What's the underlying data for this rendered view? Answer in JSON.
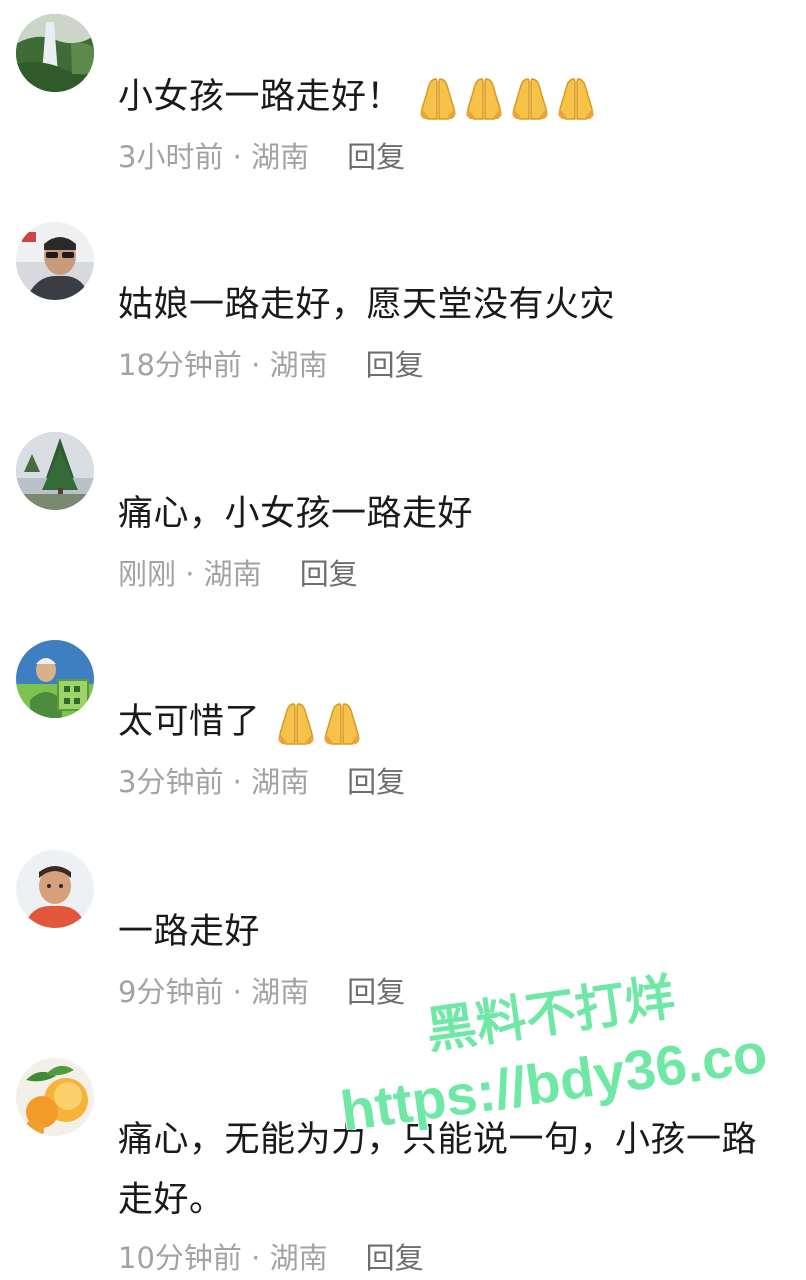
{
  "comments": [
    {
      "avatar_icon": "avatar-waterfall",
      "text": "小女孩一路走好！",
      "emoji_count": 4,
      "time": "3小时前",
      "location": "湖南",
      "reply_label": "回复"
    },
    {
      "avatar_icon": "avatar-man-sunglasses",
      "text": "姑娘一路走好，愿天堂没有火灾",
      "emoji_count": 0,
      "time": "18分钟前",
      "location": "湖南",
      "reply_label": "回复"
    },
    {
      "avatar_icon": "avatar-tree",
      "text": "痛心，小女孩一路走好",
      "emoji_count": 0,
      "time": "刚刚",
      "location": "湖南",
      "reply_label": "回复"
    },
    {
      "avatar_icon": "avatar-elderly-woman",
      "text": "太可惜了",
      "emoji_count": 2,
      "time": "3分钟前",
      "location": "湖南",
      "reply_label": "回复"
    },
    {
      "avatar_icon": "avatar-man-portrait",
      "text": "一路走好",
      "emoji_count": 0,
      "time": "9分钟前",
      "location": "湖南",
      "reply_label": "回复"
    },
    {
      "avatar_icon": "avatar-peaches",
      "text": "痛心，无能为力，只能说一句，小孩一路走好。",
      "emoji_count": 0,
      "time": "10分钟前",
      "location": "湖南",
      "reply_label": "回复"
    }
  ],
  "separator": " · ",
  "emoji_icon": "folded-hands-emoji",
  "watermark": {
    "line1": "黑料不打烊",
    "line2": "https://bdy36.co",
    "color": "#6fe8a6"
  }
}
